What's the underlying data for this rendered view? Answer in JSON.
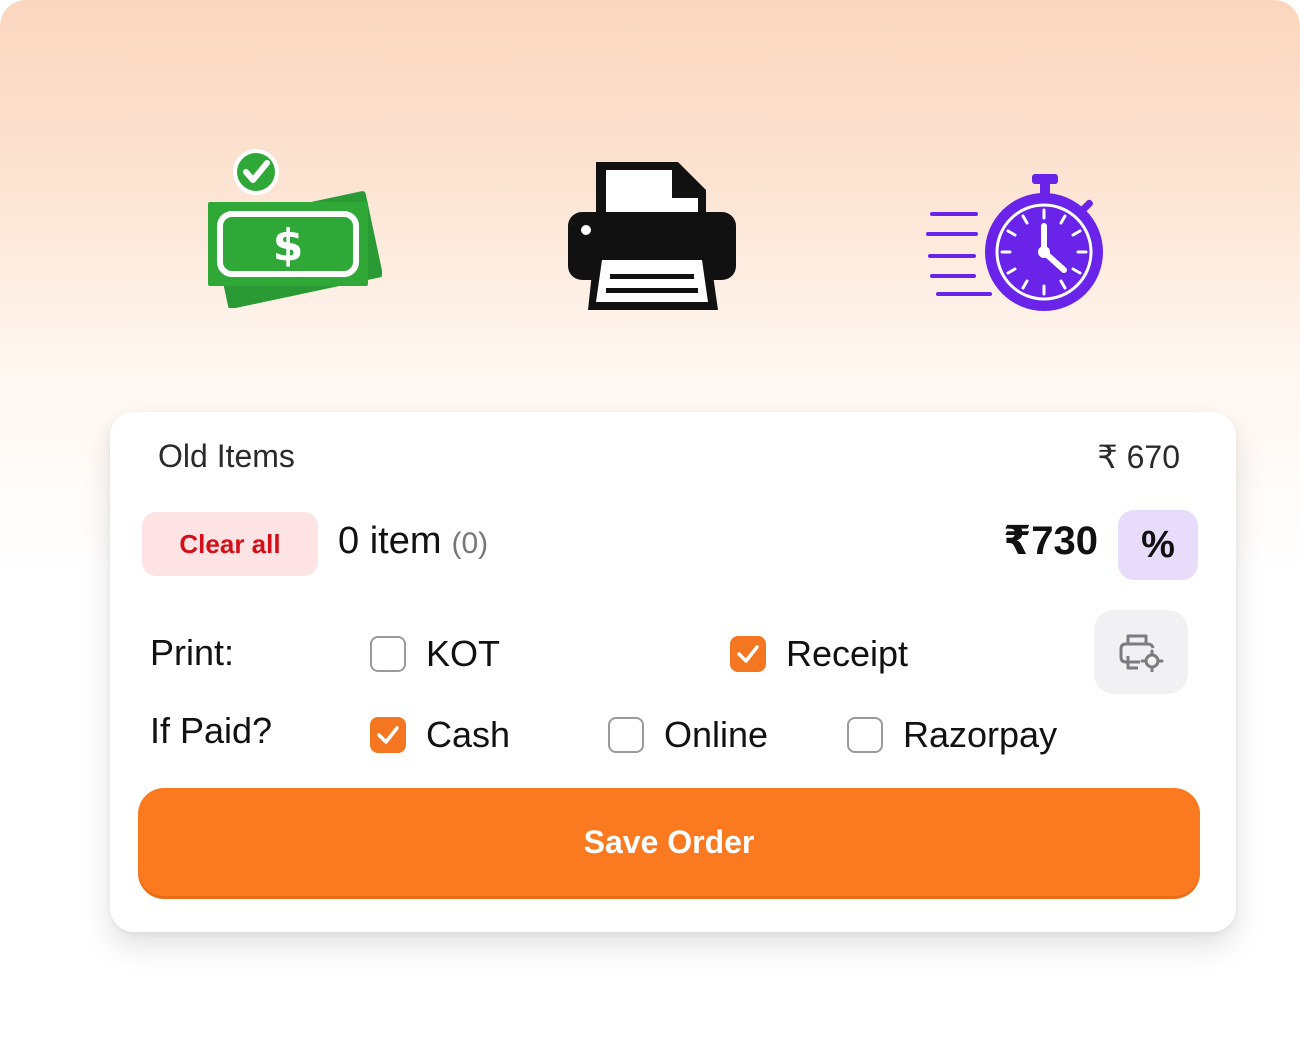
{
  "icons": [
    "money-icon",
    "printer-icon",
    "timer-icon"
  ],
  "colors": {
    "accent_orange": "#fb7a1f",
    "checkbox_checked": "#f47621",
    "clear_text": "#d40f19",
    "clear_bg": "#fde3e3",
    "discount_bg": "#e8dcfb",
    "money_green": "#2fa838",
    "timer_purple": "#6a23e8"
  },
  "summary": {
    "old_items_label": "Old Items",
    "old_items_value": "₹ 670",
    "clear_all_label": "Clear all",
    "item_count": "0 item",
    "item_count_sub": "(0)",
    "total": "₹730",
    "discount_symbol": "%"
  },
  "print": {
    "label": "Print:",
    "options": [
      {
        "label": "KOT",
        "checked": false
      },
      {
        "label": "Receipt",
        "checked": true
      }
    ],
    "settings_icon": "printer-settings-icon"
  },
  "payment": {
    "label": "If Paid?",
    "options": [
      {
        "label": "Cash",
        "checked": true
      },
      {
        "label": "Online",
        "checked": false
      },
      {
        "label": "Razorpay",
        "checked": false
      }
    ]
  },
  "save_button_label": "Save Order"
}
